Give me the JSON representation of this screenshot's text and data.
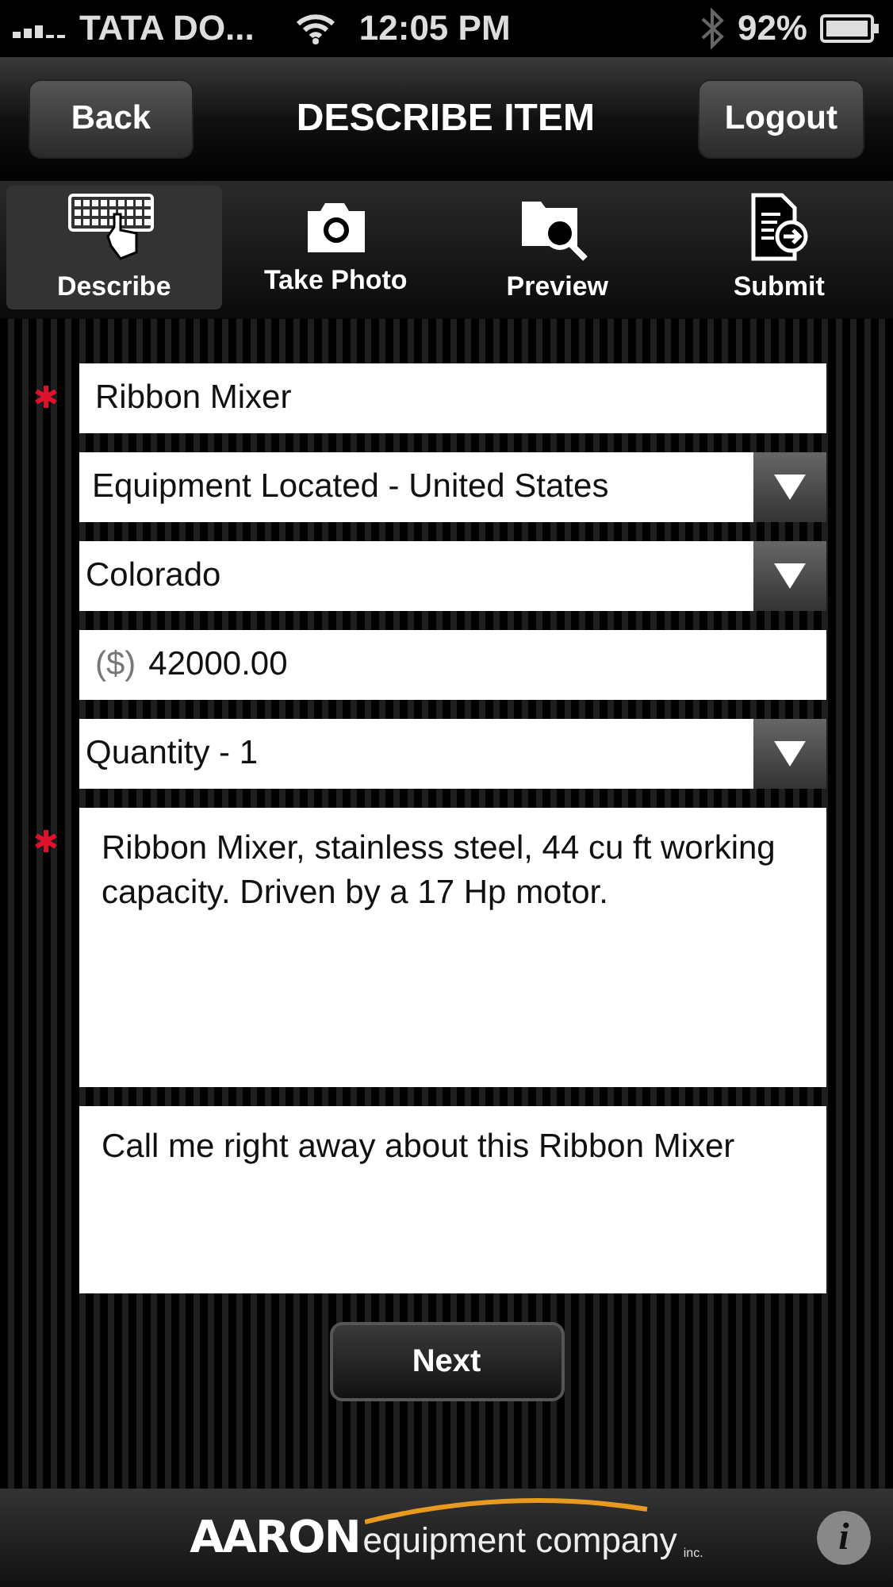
{
  "status_bar": {
    "carrier": "TATA DO...",
    "time": "12:05 PM",
    "battery": "92%"
  },
  "nav_bar": {
    "back": "Back",
    "title": "DESCRIBE ITEM",
    "logout": "Logout"
  },
  "tabs": [
    {
      "label": "Describe",
      "kind": "keyboard",
      "selected": true
    },
    {
      "label": "Take Photo",
      "kind": "camera",
      "selected": false
    },
    {
      "label": "Preview",
      "kind": "preview",
      "selected": false
    },
    {
      "label": "Submit",
      "kind": "submit",
      "selected": false
    }
  ],
  "fields": [
    {
      "kind": "text",
      "value": "Ribbon Mixer",
      "required": true
    },
    {
      "kind": "select",
      "value": "Equipment Located -  United States",
      "required": false
    },
    {
      "kind": "select",
      "value": "Colorado",
      "required": false
    },
    {
      "kind": "price",
      "prefix": "($)",
      "value": "42000.00",
      "required": false
    },
    {
      "kind": "select",
      "value": "Quantity -  1",
      "required": false
    },
    {
      "kind": "textarea",
      "value": "Ribbon Mixer, stainless steel, 44 cu ft working capacity. Driven by a 17 Hp motor.",
      "required": true
    },
    {
      "kind": "textarea",
      "value": "Call me right away about this Ribbon Mixer",
      "required": false
    }
  ],
  "next_button": "Next",
  "footer": {
    "logo_mark": "AARON",
    "logo_text": "equipment company",
    "logo_suffix": "inc.",
    "info_button": "i"
  }
}
